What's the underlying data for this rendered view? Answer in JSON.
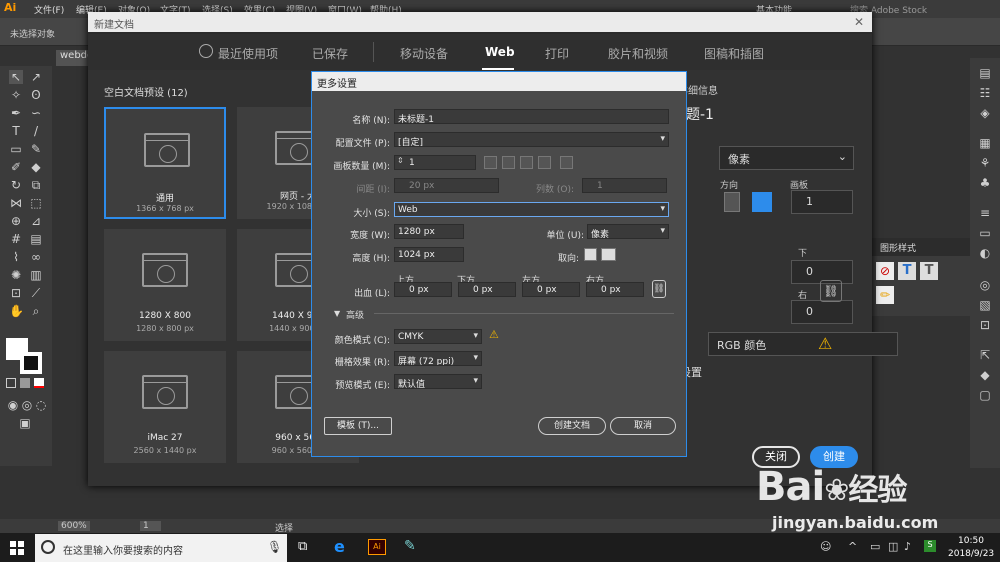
{
  "app": {
    "logo": "Ai",
    "menu": [
      "文件(F)",
      "编辑(E)",
      "对象(O)",
      "文字(T)",
      "选择(S)",
      "效果(C)",
      "视图(V)",
      "窗口(W)",
      "帮助(H)"
    ],
    "workspace": "基本功能",
    "stock_search": "搜索 Adobe Stock",
    "control_bar_text": "未选择对象",
    "doc_tab": "webde",
    "zoom": "600%",
    "artboard_num": "1",
    "status_tool": "选择"
  },
  "panel": {
    "title": "图形样式"
  },
  "new_doc": {
    "title": "新建文档",
    "tabs": [
      "最近使用项",
      "已保存",
      "移动设备",
      "Web",
      "打印",
      "胶片和视频",
      "图稿和插图"
    ],
    "active_tab": "Web",
    "preset_label": "空白文档预设 (12)",
    "presets": [
      {
        "name": "通用",
        "size": "1366 x 768 px"
      },
      {
        "name": "网页 - 大",
        "size": "1920 x 1080 px"
      },
      {
        "name": "1280 X 800",
        "size": "1280 x 800 px"
      },
      {
        "name": "1440 X 900",
        "size": "1440 x 900 px"
      },
      {
        "name": "iMac 27",
        "size": "2560 x 1440 px"
      },
      {
        "name": "960 x 560",
        "size": "960 x 560 px"
      }
    ],
    "right": {
      "details_heading": "预设详细信息",
      "name": "未标题-1",
      "unit": "像素",
      "orientation_label": "方向",
      "artboards_label": "画板",
      "artboards_value": "1",
      "bleed_bottom_label": "下",
      "bleed_bottom_value": "0",
      "bleed_right_label": "右",
      "bleed_right_value": "0",
      "color_mode": "RGB 颜色",
      "advanced_settings": "更多设置",
      "close_btn": "关闭",
      "create_btn": "创建"
    }
  },
  "more_settings": {
    "title": "更多设置",
    "name_label": "名称 (N):",
    "name_value": "未标题-1",
    "profile_label": "配置文件 (P):",
    "profile_value": "[自定]",
    "artboards_label": "画板数量 (M):",
    "artboards_value": "1",
    "spacing_label": "间距 (I):",
    "spacing_value": "20 px",
    "columns_label": "列数 (O):",
    "columns_value": "1",
    "size_label": "大小 (S):",
    "size_value": "Web",
    "width_label": "宽度 (W):",
    "width_value": "1280 px",
    "units_label": "单位 (U):",
    "units_value": "像素",
    "height_label": "高度 (H):",
    "height_value": "1024 px",
    "orientation_label": "取向:",
    "bleed_label": "出血 (L):",
    "bleed_top_label": "上方",
    "bleed_bottom_label": "下方",
    "bleed_left_label": "左方",
    "bleed_right_label": "右方",
    "bleed_top": "0 px",
    "bleed_bottom": "0 px",
    "bleed_left": "0 px",
    "bleed_right": "0 px",
    "advanced_label": "高级",
    "color_mode_label": "颜色模式 (C):",
    "color_mode_value": "CMYK",
    "raster_label": "栅格效果 (R):",
    "raster_value": "屏幕 (72 ppi)",
    "preview_label": "预览模式 (E):",
    "preview_value": "默认值",
    "template_btn": "模板 (T)...",
    "create_btn": "创建文档",
    "cancel_btn": "取消"
  },
  "taskbar": {
    "search_placeholder": "在这里输入你要搜索的内容",
    "time": "10:50",
    "date": "2018/9/23"
  },
  "watermark": {
    "text": "Bai",
    "sub": "经验",
    "url": "jingyan.baidu.com"
  }
}
